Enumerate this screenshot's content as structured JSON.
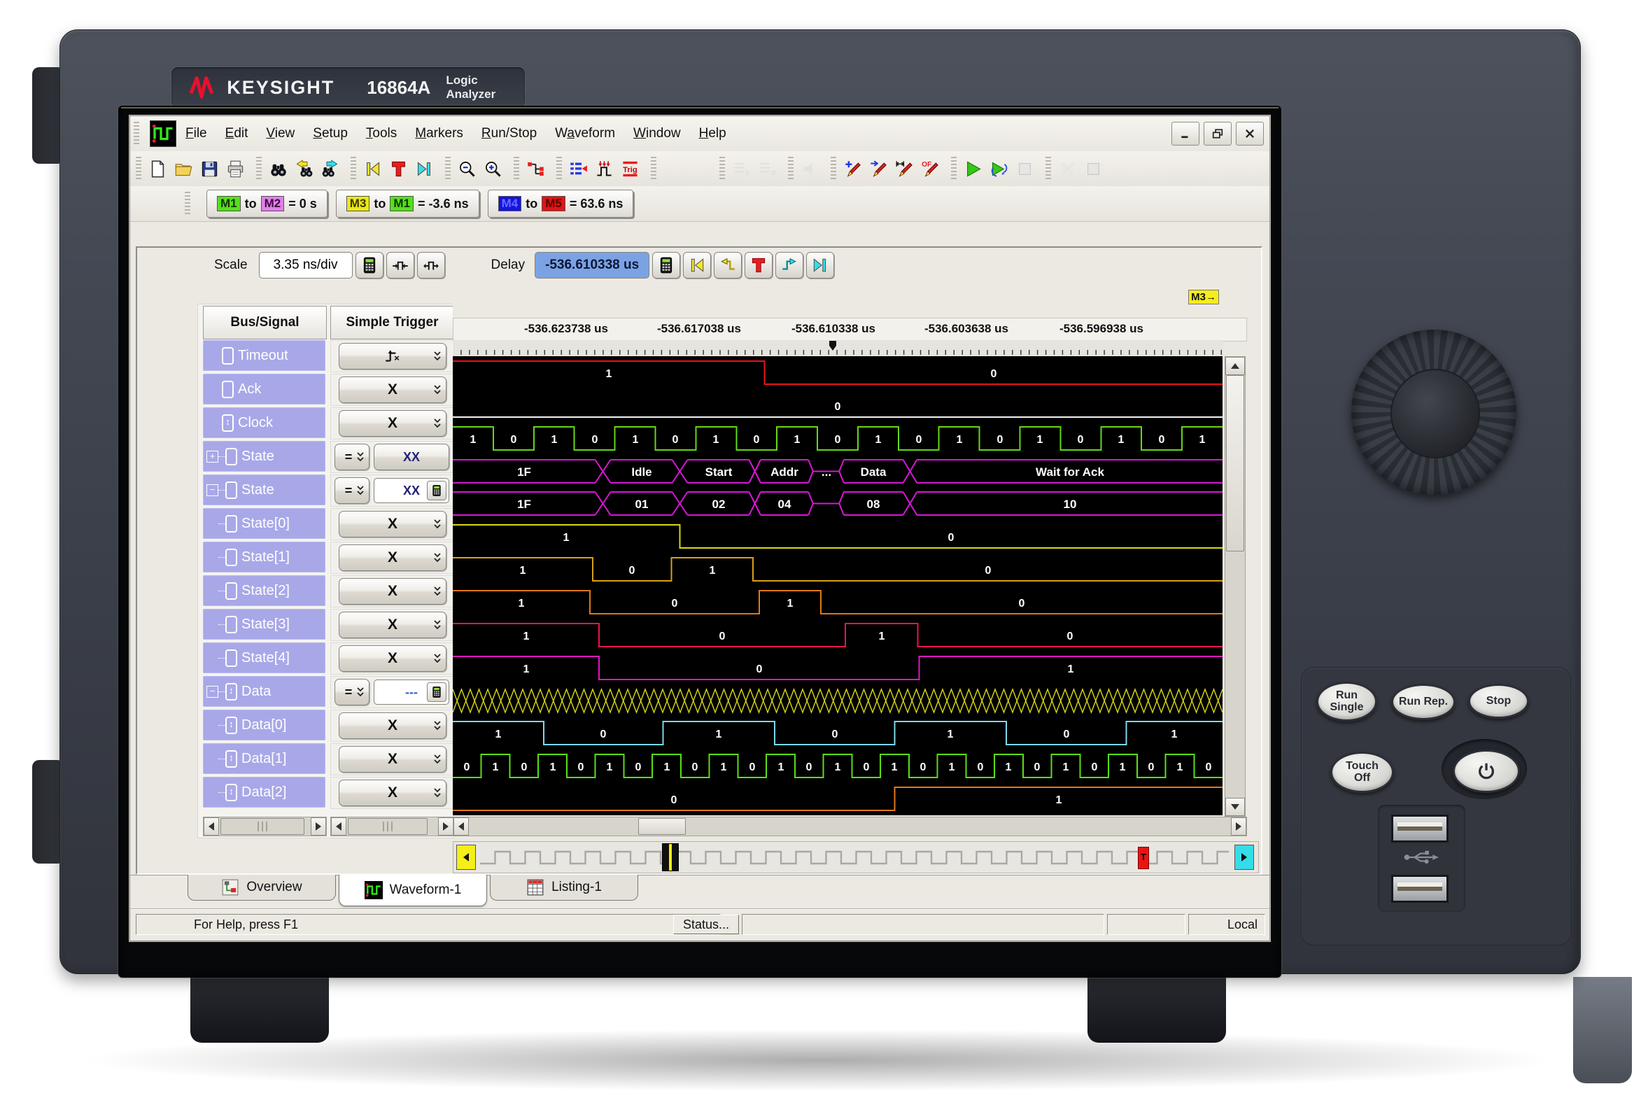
{
  "device": {
    "brand": "KEYSIGHT",
    "model": "16864A",
    "product": "Logic Analyzer"
  },
  "menu": {
    "items": [
      {
        "label": "File",
        "accel": 0
      },
      {
        "label": "Edit",
        "accel": 0
      },
      {
        "label": "View",
        "accel": 0
      },
      {
        "label": "Setup",
        "accel": 0
      },
      {
        "label": "Tools",
        "accel": 0
      },
      {
        "label": "Markers",
        "accel": 0
      },
      {
        "label": "Run/Stop",
        "accel": 0
      },
      {
        "label": "Waveform",
        "accel": 1
      },
      {
        "label": "Window",
        "accel": 0
      },
      {
        "label": "Help",
        "accel": 0
      }
    ]
  },
  "titlebar": {
    "window_buttons": [
      "minimize-icon",
      "restore-icon",
      "close-icon"
    ]
  },
  "toolbar": {
    "groups": [
      {
        "icons": [
          {
            "name": "new-file-icon",
            "enabled": true
          },
          {
            "name": "open-folder-icon",
            "enabled": true
          },
          {
            "name": "save-icon",
            "enabled": true
          },
          {
            "name": "print-icon",
            "enabled": true
          }
        ]
      },
      {
        "icons": [
          {
            "name": "find-icon",
            "enabled": true
          },
          {
            "name": "find-prev-icon",
            "enabled": true
          },
          {
            "name": "find-next-icon",
            "enabled": true
          }
        ]
      },
      {
        "icons": [
          {
            "name": "goto-begin-icon",
            "enabled": true
          },
          {
            "name": "goto-trigger-icon",
            "enabled": true
          },
          {
            "name": "goto-end-icon",
            "enabled": true
          }
        ]
      },
      {
        "icons": [
          {
            "name": "zoom-out-icon",
            "enabled": true
          },
          {
            "name": "zoom-in-icon",
            "enabled": true
          }
        ]
      },
      {
        "icons": [
          {
            "name": "probe-tree-icon",
            "enabled": true
          }
        ]
      },
      {
        "icons": [
          {
            "name": "bus-signal-setup-icon",
            "enabled": true
          },
          {
            "name": "sampling-setup-icon",
            "enabled": true
          },
          {
            "name": "trigger-setup-icon",
            "enabled": true
          }
        ]
      },
      {
        "icons": [
          {
            "name": "bus-signal-import-icon",
            "enabled": false
          },
          {
            "name": "trigger-import-icon",
            "enabled": false
          }
        ]
      },
      {
        "icons": [
          {
            "name": "run-all-icon",
            "enabled": false
          },
          {
            "name": "stop-all-icon",
            "enabled": false
          }
        ]
      },
      {
        "icons": [
          {
            "name": "sound-icon",
            "enabled": false
          }
        ]
      },
      {
        "icons": [
          {
            "name": "marker-new-icon",
            "enabled": true
          },
          {
            "name": "marker-goto-icon",
            "enabled": true
          },
          {
            "name": "marker-interval-icon",
            "enabled": true
          },
          {
            "name": "marker-overflow-icon",
            "enabled": true
          }
        ]
      },
      {
        "icons": [
          {
            "name": "run-icon",
            "enabled": true
          },
          {
            "name": "run-repetitive-icon",
            "enabled": true
          },
          {
            "name": "stop-icon",
            "enabled": false
          }
        ]
      },
      {
        "icons": [
          {
            "name": "cancel-icon",
            "enabled": false
          },
          {
            "name": "halt-icon",
            "enabled": false
          }
        ]
      }
    ]
  },
  "marker_bar": {
    "buttons": [
      {
        "a": "M1",
        "a_color": "#55e01c",
        "a_text": "#103300",
        "b": "M2",
        "b_color": "#e080ec",
        "b_text": "#40083e",
        "text": "= 0 s"
      },
      {
        "a": "M3",
        "a_color": "#ece814",
        "a_text": "#3a3800",
        "b": "M1",
        "b_color": "#55e01c",
        "b_text": "#103300",
        "text": "= -3.6 ns"
      },
      {
        "a": "M4",
        "a_color": "#1414e0",
        "a_text": "#6a6aff",
        "b": "M5",
        "b_color": "#e01414",
        "b_text": "#5a0000",
        "text": "= 63.6 ns"
      }
    ]
  },
  "scale_bar": {
    "scale_label": "Scale",
    "scale_value": "3.35 ns/div",
    "scale_buttons": [
      "calculator-icon",
      "zoom-in-time-icon",
      "zoom-out-time-icon"
    ],
    "delay_label": "Delay",
    "delay_value": "-536.610338 us",
    "delay_buttons": [
      "calculator-icon",
      "goto-begin-icon",
      "prev-edge-icon",
      "goto-trigger-icon",
      "next-edge-icon",
      "goto-end-icon"
    ]
  },
  "columns": {
    "bus_signal_header": "Bus/Signal",
    "trigger_header": "Simple Trigger"
  },
  "timeline": {
    "marker_chip": "M3→",
    "tick_labels": [
      "-536.623738 us",
      "-536.617038 us",
      "-536.610338 us",
      "-536.603638 us",
      "-536.596938 us"
    ]
  },
  "signals": [
    {
      "name": "Timeout",
      "icon": "signal-icon",
      "child": false,
      "expand": null,
      "color": "#e81414",
      "trigger": {
        "style": "dropdown",
        "glyph": "edge-rise"
      },
      "wave": {
        "kind": "bit",
        "segments": [
          {
            "v": "1",
            "to": 0.405
          },
          {
            "v": "0",
            "to": 1
          }
        ]
      }
    },
    {
      "name": "Ack",
      "icon": "signal-icon",
      "child": false,
      "expand": null,
      "color": "#f2f2f2",
      "trigger": {
        "style": "dropdown",
        "glyph": "X"
      },
      "wave": {
        "kind": "bit",
        "segments": [
          {
            "v": "0",
            "to": 1
          }
        ]
      }
    },
    {
      "name": "Clock",
      "icon": "signal-activity-icon",
      "child": false,
      "expand": null,
      "color": "#63d816",
      "trigger": {
        "style": "dropdown",
        "glyph": "X"
      },
      "wave": {
        "kind": "clock",
        "start": "1",
        "halves": 19
      }
    },
    {
      "name": "State",
      "icon": "bus-icon",
      "child": false,
      "expand": "plus",
      "color": "#d816d8",
      "trigger": {
        "style": "compare",
        "value": "XX",
        "input": false
      },
      "wave": {
        "kind": "bus",
        "segments": [
          {
            "label": "1F",
            "from": 0,
            "to": 0.185
          },
          {
            "label": "Idle",
            "from": 0.205,
            "to": 0.285
          },
          {
            "label": "Start",
            "from": 0.305,
            "to": 0.385
          },
          {
            "label": "Addr",
            "from": 0.4,
            "to": 0.462
          },
          {
            "label": "...",
            "from": 0.468,
            "to": 0.502,
            "collapsed": true
          },
          {
            "label": "Data",
            "from": 0.508,
            "to": 0.585
          },
          {
            "label": "Wait for Ack",
            "from": 0.603,
            "to": 1
          }
        ]
      }
    },
    {
      "name": "State",
      "icon": "bus-icon",
      "child": false,
      "expand": "minus",
      "color": "#d816d8",
      "trigger": {
        "style": "compare",
        "value": "XX",
        "input": true
      },
      "wave": {
        "kind": "bus",
        "segments": [
          {
            "label": "1F",
            "from": 0,
            "to": 0.185
          },
          {
            "label": "01",
            "from": 0.205,
            "to": 0.285
          },
          {
            "label": "02",
            "from": 0.305,
            "to": 0.385
          },
          {
            "label": "04",
            "from": 0.4,
            "to": 0.462
          },
          {
            "label": "",
            "from": 0.468,
            "to": 0.502,
            "collapsed": true
          },
          {
            "label": "08",
            "from": 0.508,
            "to": 0.585
          },
          {
            "label": "10",
            "from": 0.603,
            "to": 1
          }
        ]
      }
    },
    {
      "name": "State[0]",
      "icon": "signal-icon",
      "child": true,
      "expand": null,
      "color": "#d8d816",
      "trigger": {
        "style": "dropdown",
        "glyph": "X"
      },
      "wave": {
        "kind": "bit",
        "segments": [
          {
            "v": "1",
            "to": 0.295
          },
          {
            "v": "0",
            "to": 1
          }
        ]
      }
    },
    {
      "name": "State[1]",
      "icon": "signal-icon",
      "child": true,
      "expand": null,
      "color": "#d8a016",
      "trigger": {
        "style": "dropdown",
        "glyph": "X"
      },
      "wave": {
        "kind": "bit",
        "segments": [
          {
            "v": "1",
            "to": 0.182
          },
          {
            "v": "0",
            "to": 0.284
          },
          {
            "v": "1",
            "to": 0.39
          },
          {
            "v": "0",
            "to": 1
          }
        ]
      }
    },
    {
      "name": "State[2]",
      "icon": "signal-icon",
      "child": true,
      "expand": null,
      "color": "#e07816",
      "trigger": {
        "style": "dropdown",
        "glyph": "X"
      },
      "wave": {
        "kind": "bit",
        "segments": [
          {
            "v": "1",
            "to": 0.178
          },
          {
            "v": "0",
            "to": 0.398
          },
          {
            "v": "1",
            "to": 0.478
          },
          {
            "v": "0",
            "to": 1
          }
        ]
      }
    },
    {
      "name": "State[3]",
      "icon": "signal-icon",
      "child": true,
      "expand": null,
      "color": "#e8164f",
      "trigger": {
        "style": "dropdown",
        "glyph": "X"
      },
      "wave": {
        "kind": "bit",
        "segments": [
          {
            "v": "1",
            "to": 0.19
          },
          {
            "v": "0",
            "to": 0.51
          },
          {
            "v": "1",
            "to": 0.604
          },
          {
            "v": "0",
            "to": 1
          }
        ]
      }
    },
    {
      "name": "State[4]",
      "icon": "signal-icon",
      "child": true,
      "expand": null,
      "color": "#e016c0",
      "trigger": {
        "style": "dropdown",
        "glyph": "X"
      },
      "wave": {
        "kind": "bit",
        "segments": [
          {
            "v": "1",
            "to": 0.19
          },
          {
            "v": "0",
            "to": 0.606
          },
          {
            "v": "1",
            "to": 1
          }
        ]
      }
    },
    {
      "name": "Data",
      "icon": "bus-activity-icon",
      "child": false,
      "expand": "minus",
      "color": "#d8d816",
      "trigger": {
        "style": "compare",
        "value": "---",
        "input": true
      },
      "wave": {
        "kind": "crosshatch",
        "cells": 88
      }
    },
    {
      "name": "Data[0]",
      "icon": "signal-activity-icon",
      "child": true,
      "expand": null,
      "color": "#7cd8ec",
      "trigger": {
        "style": "dropdown",
        "glyph": "X"
      },
      "wave": {
        "kind": "bit",
        "segments": [
          {
            "v": "1",
            "to": 0.118
          },
          {
            "v": "0",
            "to": 0.273
          },
          {
            "v": "1",
            "to": 0.418
          },
          {
            "v": "0",
            "to": 0.574
          },
          {
            "v": "1",
            "to": 0.719
          },
          {
            "v": "0",
            "to": 0.875
          },
          {
            "v": "1",
            "to": 1
          }
        ]
      }
    },
    {
      "name": "Data[1]",
      "icon": "signal-activity-icon",
      "child": true,
      "expand": null,
      "color": "#58e016",
      "trigger": {
        "style": "dropdown",
        "glyph": "X"
      },
      "wave": {
        "kind": "clock",
        "start": "0",
        "halves": 27
      }
    },
    {
      "name": "Data[2]",
      "icon": "signal-activity-icon",
      "child": true,
      "expand": null,
      "color": "#e07816",
      "trigger": {
        "style": "dropdown",
        "glyph": "X"
      },
      "wave": {
        "kind": "bit",
        "segments": [
          {
            "v": "0",
            "to": 0.574
          },
          {
            "v": "1",
            "to": 1
          }
        ]
      }
    }
  ],
  "tabs": [
    {
      "label": "Overview",
      "icon": "overview-icon",
      "active": false
    },
    {
      "label": "Waveform-1",
      "icon": "waveform-icon",
      "active": true
    },
    {
      "label": "Listing-1",
      "icon": "listing-icon",
      "active": false
    }
  ],
  "status_bar": {
    "help_text": "For Help, press F1",
    "status_button": "Status...",
    "mode": "Local"
  },
  "front_panel": {
    "buttons": [
      {
        "label": "Run\nSingle"
      },
      {
        "label": "Run Rep."
      },
      {
        "label": "Stop"
      },
      {
        "label": "Touch\nOff"
      }
    ],
    "power_icon": "power-icon",
    "usb_icon": "usb-icon"
  }
}
